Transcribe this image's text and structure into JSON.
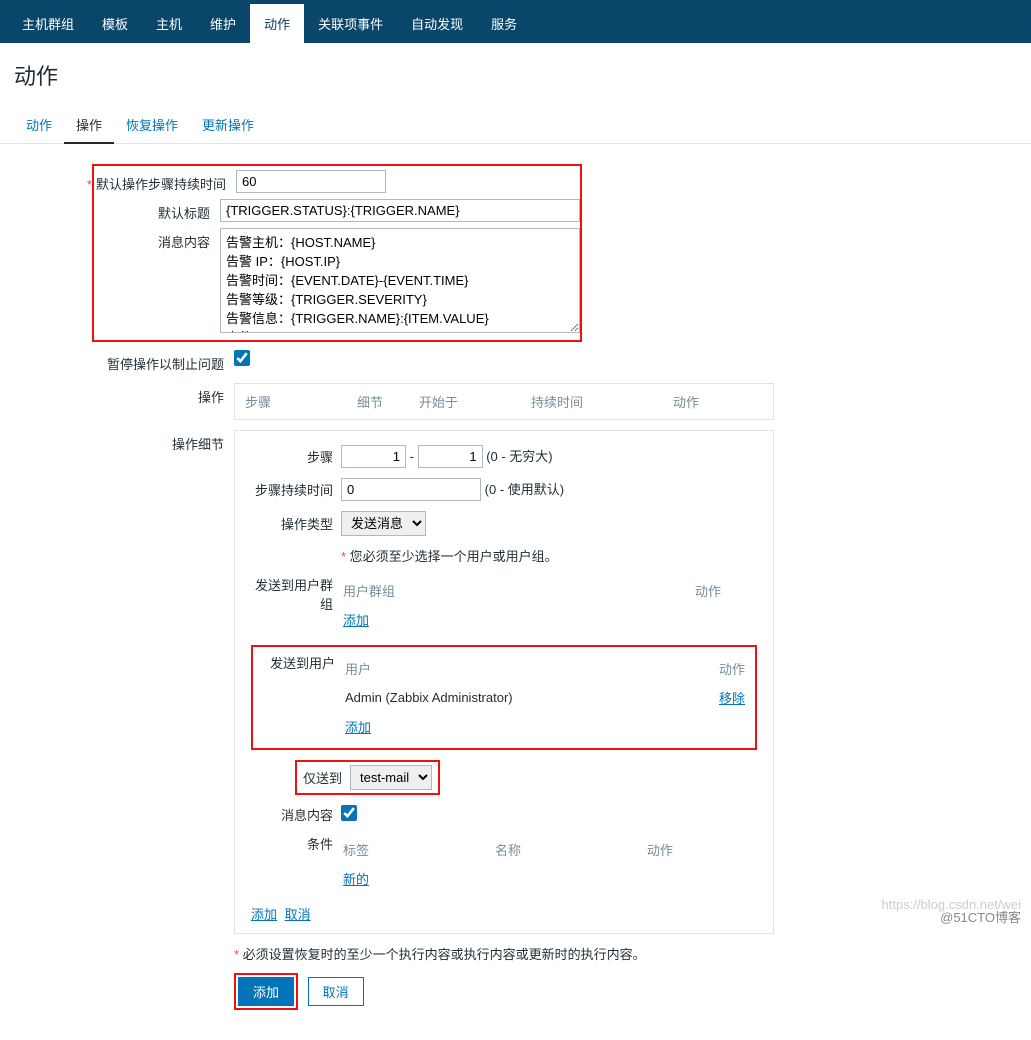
{
  "nav": {
    "items": [
      "主机群组",
      "模板",
      "主机",
      "维护",
      "动作",
      "关联项事件",
      "自动发现",
      "服务"
    ],
    "active_index": 4
  },
  "page_title": "动作",
  "tabs": {
    "items": [
      "动作",
      "操作",
      "恢复操作",
      "更新操作"
    ],
    "active_index": 1
  },
  "form": {
    "default_step_duration_label": "默认操作步骤持续时间",
    "default_step_duration_value": "60",
    "default_subject_label": "默认标题",
    "default_subject_value": "{TRIGGER.STATUS}:{TRIGGER.NAME}",
    "message_label": "消息内容",
    "message_value": "告警主机：{HOST.NAME}\n告警 IP：{HOST.IP}\n告警时间：{EVENT.DATE}-{EVENT.TIME}\n告警等级：{TRIGGER.SEVERITY}\n告警信息：{TRIGGER.NAME}:{ITEM.VALUE}\n事件 ID：{EVENT.ID}",
    "pause_label": "暂停操作以制止问题",
    "pause_checked": true,
    "operations_label": "操作",
    "operations_headers": [
      "步骤",
      "细节",
      "开始于",
      "持续时间",
      "动作"
    ],
    "details_label": "操作细节",
    "steps_label": "步骤",
    "step_from": "1",
    "step_to": "1",
    "step_hint": "(0 - 无穷大)",
    "step_duration_label": "步骤持续时间",
    "step_duration_value": "0",
    "step_duration_hint": "(0 - 使用默认)",
    "op_type_label": "操作类型",
    "op_type_value": "发送消息",
    "required_user_msg": "您必须至少选择一个用户或用户组。",
    "send_to_groups_label": "发送到用户群组",
    "groups_th_name": "用户群组",
    "groups_th_action": "动作",
    "groups_add": "添加",
    "send_to_users_label": "发送到用户",
    "users_th_name": "用户",
    "users_th_action": "动作",
    "user_row_name": "Admin (Zabbix Administrator)",
    "user_row_remove": "移除",
    "users_add": "添加",
    "only_send_label": "仅送到",
    "only_send_value": "test-mail",
    "msg_content_label": "消息内容",
    "msg_content_checked": true,
    "conditions_label": "条件",
    "cond_th_label": "标签",
    "cond_th_name": "名称",
    "cond_th_action": "动作",
    "cond_new": "新的",
    "detail_add": "添加",
    "detail_cancel": "取消",
    "recovery_required_msg": "必须设置恢复时的至少一个执行内容或执行内容或更新时的执行内容。",
    "submit_add": "添加",
    "submit_cancel": "取消"
  },
  "watermark_left": "https://blog.csdn.net/wei",
  "watermark_right": "@51CTO博客"
}
